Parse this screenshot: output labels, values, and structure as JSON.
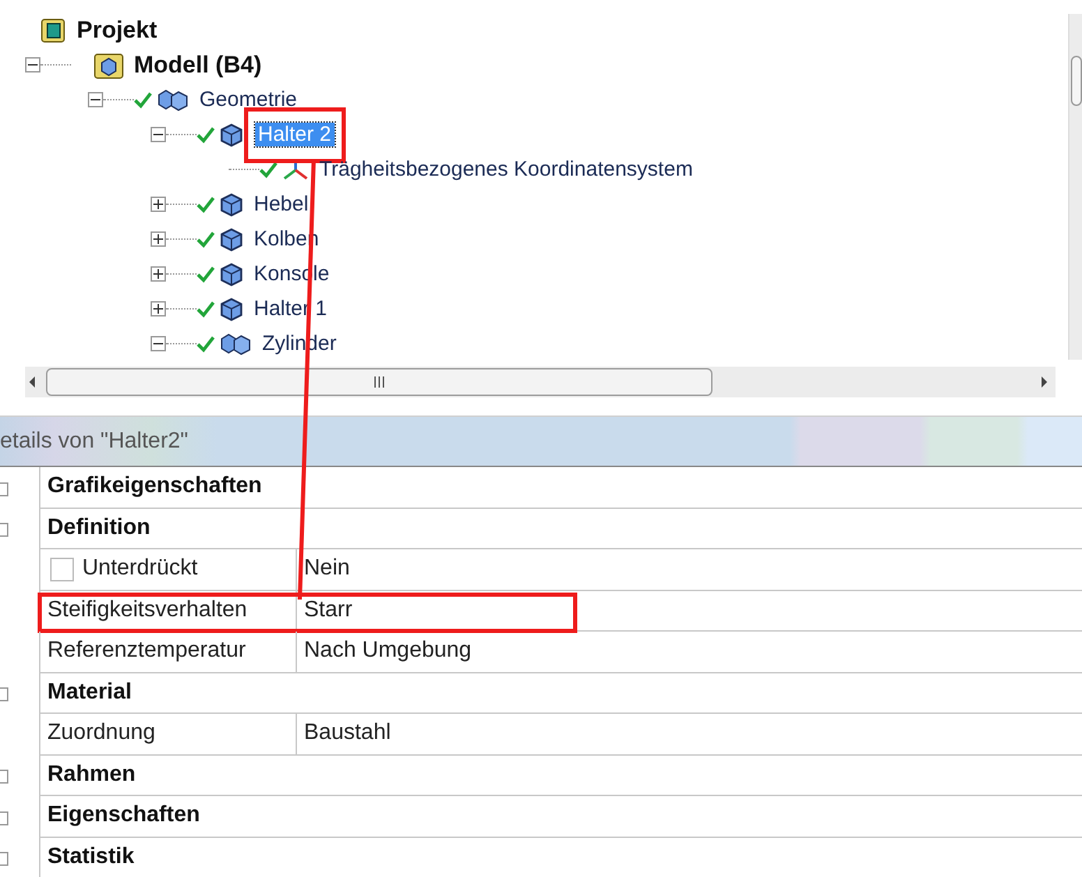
{
  "tree": [
    {
      "label": "Projekt",
      "kind": "project",
      "selected": false,
      "highlighted": false,
      "children": [
        {
          "label": "Modell (B4)",
          "kind": "model",
          "checked": false,
          "selected": false,
          "highlighted": false,
          "expanded": true,
          "children": [
            {
              "label": "Geometrie",
              "kind": "assembly",
              "checked": true,
              "selected": false,
              "highlighted": false,
              "expanded": true,
              "children": [
                {
                  "label": "Halter 2",
                  "kind": "part",
                  "checked": true,
                  "selected": true,
                  "highlighted": true,
                  "expanded": true,
                  "children": [
                    {
                      "label": "Trägheitsbezogenes Koordinatensystem",
                      "kind": "axes",
                      "checked": true,
                      "selected": false,
                      "highlighted": false
                    }
                  ]
                },
                {
                  "label": "Hebel",
                  "kind": "part",
                  "checked": true,
                  "selected": false,
                  "highlighted": false,
                  "expanded": false
                },
                {
                  "label": "Kolben",
                  "kind": "part",
                  "checked": true,
                  "selected": false,
                  "highlighted": false,
                  "expanded": false
                },
                {
                  "label": "Konsole",
                  "kind": "part",
                  "checked": true,
                  "selected": false,
                  "highlighted": false,
                  "expanded": false
                },
                {
                  "label": "Halter 1",
                  "kind": "part",
                  "checked": true,
                  "selected": false,
                  "highlighted": false,
                  "expanded": false
                },
                {
                  "label": "Zylinder",
                  "kind": "assembly",
                  "checked": true,
                  "selected": false,
                  "highlighted": false,
                  "expanded": true
                }
              ]
            }
          ]
        }
      ]
    }
  ],
  "details": {
    "title": "etails von \"Halter2\"",
    "rows": [
      {
        "kind": "group",
        "label": "Grafikeigenschaften"
      },
      {
        "kind": "group",
        "label": "Definition"
      },
      {
        "kind": "property",
        "label": "Unterdrückt",
        "value": "Nein",
        "checked": false,
        "highlighted": false
      },
      {
        "kind": "property",
        "label": "Steifigkeitsverhalten",
        "value": "Starr",
        "highlighted": true
      },
      {
        "kind": "property",
        "label": "Referenztemperatur",
        "value": "Nach Umgebung",
        "highlighted": false
      },
      {
        "kind": "group",
        "label": "Material"
      },
      {
        "kind": "property",
        "label": "Zuordnung",
        "value": "Baustahl",
        "highlighted": false
      },
      {
        "kind": "group",
        "label": "Rahmen"
      },
      {
        "kind": "group",
        "label": "Eigenschaften"
      },
      {
        "kind": "group",
        "label": "Statistik"
      }
    ]
  }
}
